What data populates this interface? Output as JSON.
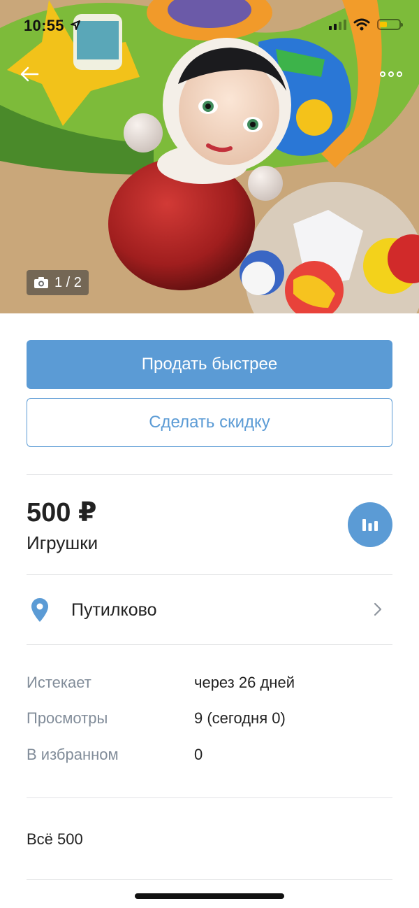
{
  "status_bar": {
    "time": "10:55",
    "location_arrow_icon": "location-arrow-icon",
    "signal_icon": "cellular-signal-icon",
    "wifi_icon": "wifi-icon",
    "battery_icon": "battery-icon",
    "battery_color": "#f5c400"
  },
  "header": {
    "back_icon": "arrow-left-icon",
    "more_icon": "more-horizontal-icon"
  },
  "photo": {
    "counter": "1 / 2",
    "camera_icon": "camera-icon"
  },
  "actions": {
    "sell_faster_label": "Продать быстрее",
    "discount_label": "Сделать скидку"
  },
  "listing": {
    "price": "500 ₽",
    "category": "Игрушки",
    "stats_icon": "bar-chart-icon"
  },
  "location": {
    "name": "Путилково",
    "pin_icon": "map-pin-icon",
    "chevron_icon": "chevron-right-icon"
  },
  "info": {
    "rows": [
      {
        "label": "Истекает",
        "value": "через 26 дней"
      },
      {
        "label": "Просмотры",
        "value": "9 (сегодня 0)"
      },
      {
        "label": "В избранном",
        "value": "0"
      }
    ]
  },
  "description": "Всё 500",
  "colors": {
    "accent": "#5b9bd5",
    "secondary_text": "#818c99",
    "divider": "#e3e4e6"
  }
}
